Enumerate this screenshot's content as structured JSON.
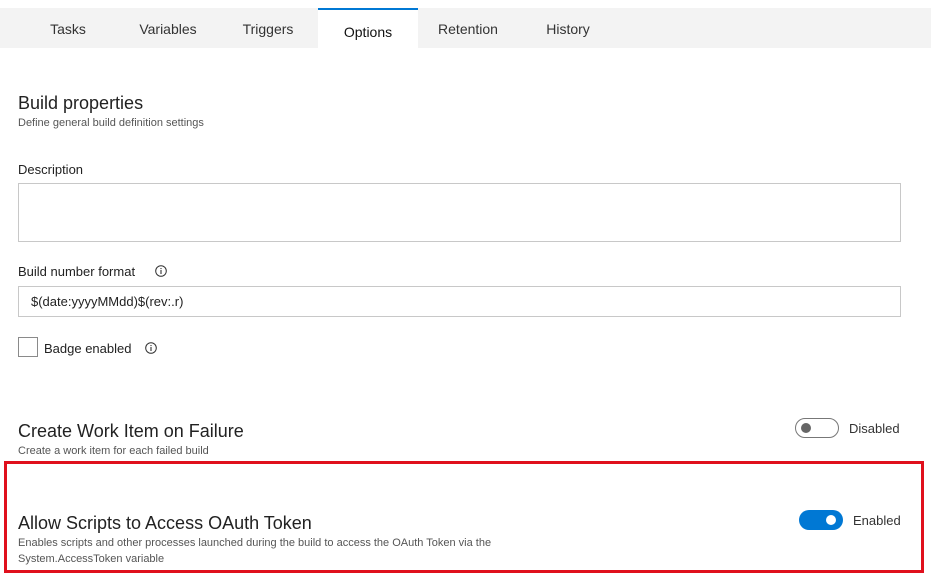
{
  "tabs": [
    {
      "label": "Tasks"
    },
    {
      "label": "Variables"
    },
    {
      "label": "Triggers"
    },
    {
      "label": "Options",
      "active": true
    },
    {
      "label": "Retention"
    },
    {
      "label": "History"
    }
  ],
  "build_properties": {
    "title": "Build properties",
    "subtitle": "Define general build definition settings"
  },
  "description": {
    "label": "Description",
    "value": ""
  },
  "build_number_format": {
    "label": "Build number format",
    "value": "$(date:yyyyMMdd)$(rev:.r)"
  },
  "badge": {
    "label": "Badge enabled",
    "checked": false
  },
  "work_item_on_failure": {
    "title": "Create Work Item on Failure",
    "subtitle": "Create a work item for each failed build",
    "toggle_state": "Disabled",
    "enabled": false
  },
  "oauth_token": {
    "title": "Allow Scripts to Access OAuth Token",
    "subtitle_line1": "Enables scripts and other processes launched during the build to access the OAuth Token via the",
    "subtitle_line2": "System.AccessToken variable",
    "toggle_state": "Enabled",
    "enabled": true
  },
  "icons": {
    "info": "info-circle-icon"
  },
  "colors": {
    "accent": "#0078d4",
    "highlight": "#e0101d",
    "tab_bar": "#f3f3f3"
  }
}
